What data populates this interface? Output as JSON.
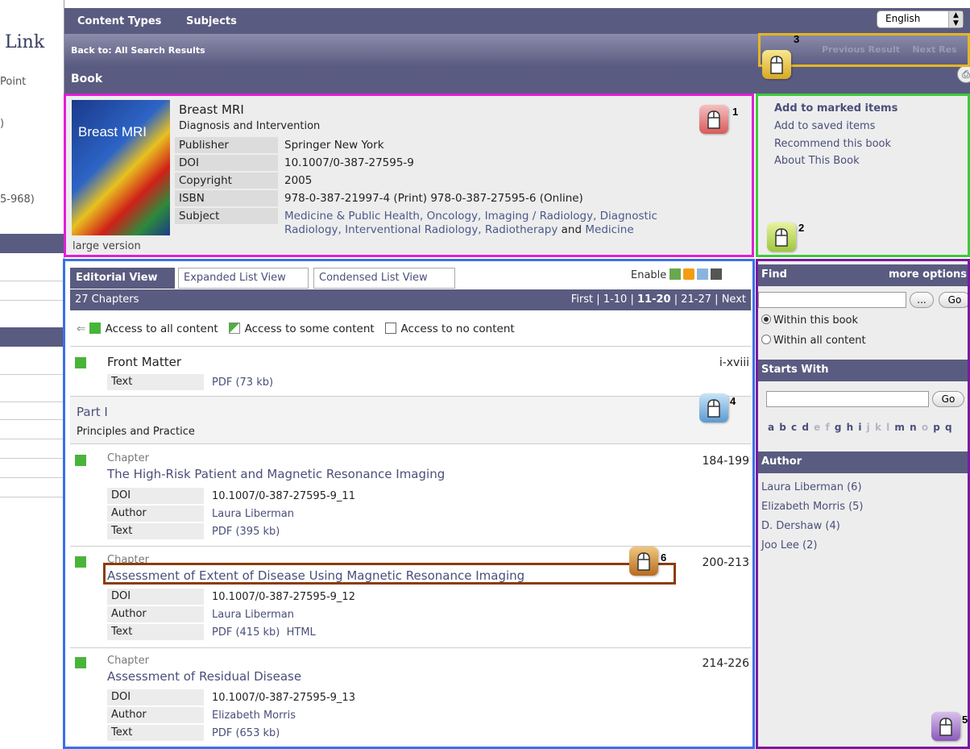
{
  "left_strip": {
    "logo": "Link",
    "text1": "Point",
    "text2": ")",
    "text3": "5-968)"
  },
  "nav": {
    "content_types": "Content Types",
    "subjects": "Subjects",
    "language": "English",
    "back_label": "Back to: All Search Results",
    "section_title": "Book",
    "previous_result": "Previous Result",
    "next_result": "Next Res"
  },
  "book": {
    "title": "Breast MRI",
    "subtitle": "Diagnosis and Intervention",
    "cover_title": "Breast MRI",
    "large_version": "large version",
    "meta": [
      {
        "key": "Publisher",
        "value": "Springer New York"
      },
      {
        "key": "DOI",
        "value": "10.1007/0-387-27595-9"
      },
      {
        "key": "Copyright",
        "value": "2005"
      },
      {
        "key": "ISBN",
        "value": "978-0-387-21997-4 (Print) 978-0-387-27595-6 (Online)"
      }
    ],
    "subject_key": "Subject",
    "subject_line1": "Medicine & Public Health, Oncology, Imaging / Radiology, Diagnostic",
    "subject_line2a": "Radiology, Interventional Radiology, Radiotherapy",
    "subject_and": "and",
    "subject_line2b": "Medicine"
  },
  "actions": [
    "Add to marked items",
    "Add to saved items",
    "Recommend this book",
    "About This Book"
  ],
  "tabs": {
    "editorial": "Editorial View",
    "expanded": "Expanded List View",
    "condensed": "Condensed List View",
    "enable": "Enable"
  },
  "chapters_bar": {
    "count": "27 Chapters",
    "first": "First",
    "sep": "|",
    "p1": "1-10",
    "p2": "11-20",
    "p3": "21-27",
    "next": "Next"
  },
  "legend": {
    "all": "Access to all content",
    "some": "Access to some content",
    "none": "Access to no content"
  },
  "front_matter": {
    "title": "Front Matter",
    "pages": "i-xviii",
    "text_key": "Text",
    "text_value": "PDF (73 kb)"
  },
  "part": {
    "label": "Part I",
    "subtitle": "Principles and Practice"
  },
  "chapters": [
    {
      "type": "Chapter",
      "title": "The High-Risk Patient and Magnetic Resonance Imaging",
      "pages": "184-199",
      "doi": "10.1007/0-387-27595-9_11",
      "author": "Laura Liberman",
      "text": "PDF (395 kb)"
    },
    {
      "type": "Chapter",
      "title": "Assessment of Extent of Disease Using Magnetic Resonance Imaging",
      "pages": "200-213",
      "doi": "10.1007/0-387-27595-9_12",
      "author": "Laura Liberman",
      "text": "PDF (415 kb)",
      "html": "HTML"
    },
    {
      "type": "Chapter",
      "title": "Assessment of Residual Disease",
      "pages": "214-226",
      "doi": "10.1007/0-387-27595-9_13",
      "author": "Elizabeth Morris",
      "text": "PDF (653 kb)"
    }
  ],
  "meta_labels": {
    "doi": "DOI",
    "author": "Author",
    "text": "Text"
  },
  "sidebar": {
    "find": "Find",
    "more_options": "more options",
    "find_btn": "...",
    "go": "Go",
    "within_book": "Within this book",
    "within_all": "Within all content",
    "starts_with": "Starts With",
    "author_head": "Author",
    "authors": [
      "Laura Liberman (6)",
      "Elizabeth Morris (5)",
      "D. Dershaw (4)",
      "Joo Lee (2)"
    ]
  },
  "badges": {
    "b1": "1",
    "b2": "2",
    "b3": "3",
    "b4": "4",
    "b5": "5",
    "b6": "6"
  },
  "colors": {
    "header": "#5a5b80",
    "accent_link": "#4a4f7a",
    "green": "#49b43a",
    "hl_1": "#e21ed7",
    "hl_2": "#3ec93a",
    "hl_3": "#e3b623",
    "hl_4": "#3970e8",
    "hl_5": "#7a1aa0",
    "hl_6": "#8a3c0e"
  }
}
